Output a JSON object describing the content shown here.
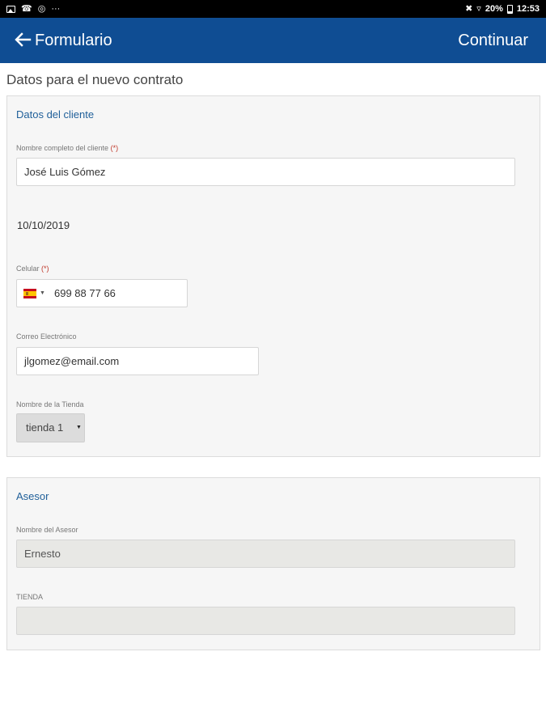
{
  "status_bar": {
    "left_icons": [
      "image-icon",
      "wifi-calling-icon",
      "whatsapp-icon",
      "more-notifications-icon"
    ],
    "more_glyph": "···",
    "battery": "20%",
    "time": "12:53"
  },
  "app_bar": {
    "title": "Formulario",
    "action": "Continuar",
    "background": "#0f4d93"
  },
  "page_heading": "Datos para el nuevo contrato",
  "client_section": {
    "title": "Datos del cliente",
    "full_name_label": "Nombre completo del cliente",
    "full_name_value": "José Luis Gómez",
    "required_mark": "(*)",
    "date": "10/10/2019",
    "phone_label": "Celular",
    "phone_country": "ES",
    "phone_value": "699 88 77 66",
    "email_label": "Correo Electrónico",
    "email_value": "jlgomez@email.com",
    "store_label": "Nombre de la Tienda",
    "store_selected": "tienda 1"
  },
  "asesor_section": {
    "title": "Asesor",
    "name_label": "Nombre del Asesor",
    "name_value": "Ernesto",
    "store_label": "TIENDA",
    "store_value": ""
  }
}
